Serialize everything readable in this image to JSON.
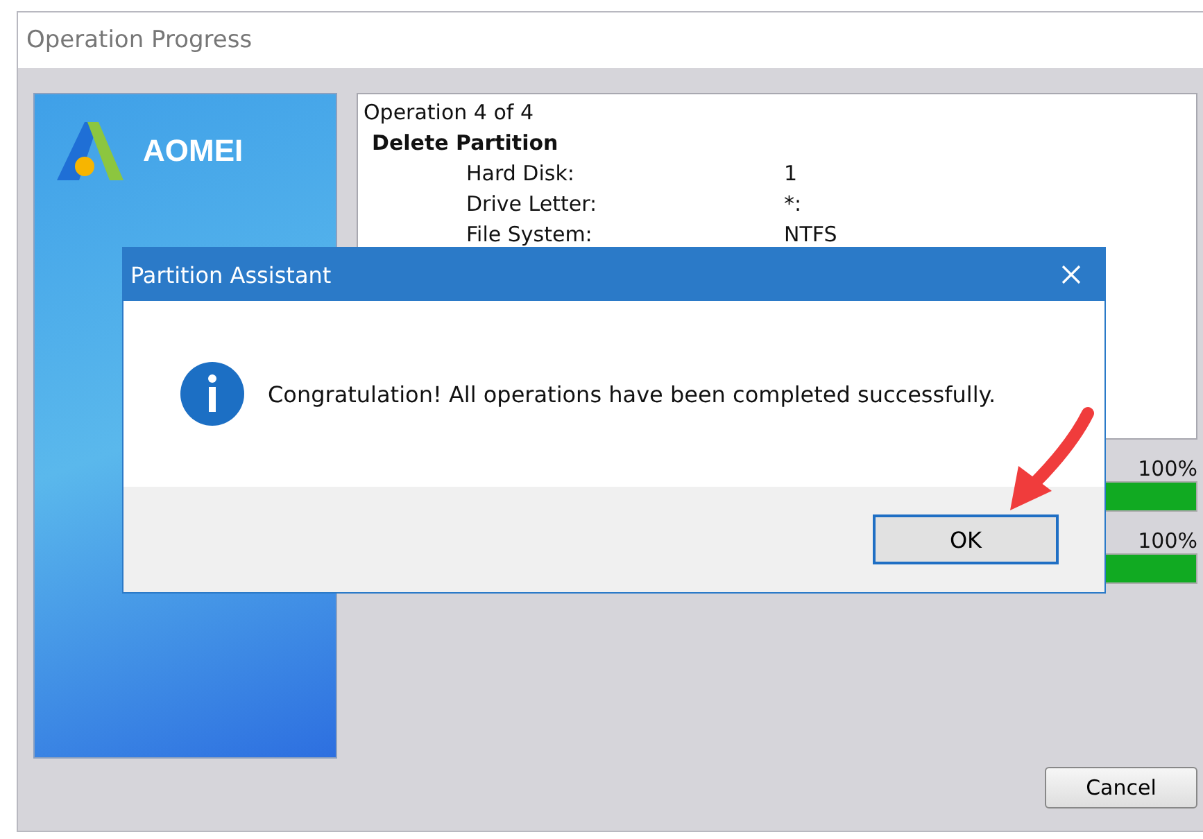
{
  "window": {
    "title": "Operation Progress"
  },
  "banner": {
    "logo_text": "AOMEI"
  },
  "operation": {
    "header": "Operation 4 of 4",
    "name": "Delete Partition",
    "details": [
      {
        "label": "Hard Disk:",
        "value": "1"
      },
      {
        "label": "Drive Letter:",
        "value": "*:"
      },
      {
        "label": "File System:",
        "value": "NTFS"
      }
    ]
  },
  "progress": [
    {
      "level": 1,
      "reading": "100%"
    },
    {
      "level": 1,
      "reading": "100%"
    }
  ],
  "buttons": [
    "Cancel"
  ],
  "dialog": {
    "title": "Partition Assistant",
    "message": "Congratulation! All operations have been completed successfully.",
    "buttons": [
      "OK"
    ]
  }
}
